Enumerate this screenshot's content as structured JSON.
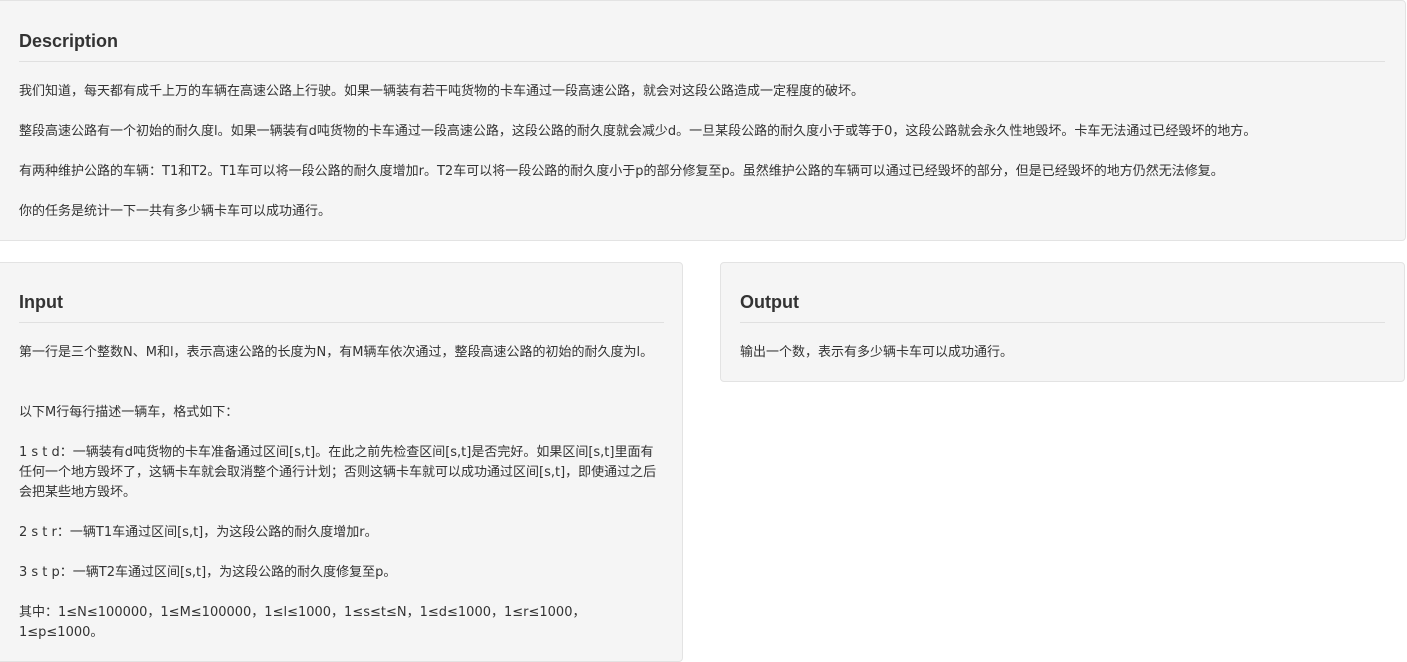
{
  "description": {
    "heading": "Description",
    "paragraphs": [
      "我们知道，每天都有成千上万的车辆在高速公路上行驶。如果一辆装有若干吨货物的卡车通过一段高速公路，就会对这段公路造成一定程度的破坏。",
      "整段高速公路有一个初始的耐久度l。如果一辆装有d吨货物的卡车通过一段高速公路，这段公路的耐久度就会减少d。一旦某段公路的耐久度小于或等于0，这段公路就会永久性地毁坏。卡车无法通过已经毁坏的地方。",
      "有两种维护公路的车辆：T1和T2。T1车可以将一段公路的耐久度增加r。T2车可以将一段公路的耐久度小于p的部分修复至p。虽然维护公路的车辆可以通过已经毁坏的部分，但是已经毁坏的地方仍然无法修复。",
      "你的任务是统计一下一共有多少辆卡车可以成功通行。"
    ]
  },
  "input": {
    "heading": "Input",
    "paragraphs": [
      "第一行是三个整数N、M和l，表示高速公路的长度为N，有M辆车依次通过，整段高速公路的初始的耐久度为l。",
      "以下M行每行描述一辆车，格式如下：",
      "1 s t d：一辆装有d吨货物的卡车准备通过区间[s,t]。在此之前先检查区间[s,t]是否完好。如果区间[s,t]里面有任何一个地方毁坏了，这辆卡车就会取消整个通行计划；否则这辆卡车就可以成功通过区间[s,t]，即使通过之后会把某些地方毁坏。",
      "2 s t r：一辆T1车通过区间[s,t]，为这段公路的耐久度增加r。",
      "3 s t p：一辆T2车通过区间[s,t]，为这段公路的耐久度修复至p。",
      "其中：1≤N≤100000，1≤M≤100000，1≤l≤1000，1≤s≤t≤N，1≤d≤1000，1≤r≤1000，1≤p≤1000。"
    ]
  },
  "output": {
    "heading": "Output",
    "paragraphs": [
      "输出一个数，表示有多少辆卡车可以成功通行。"
    ]
  }
}
